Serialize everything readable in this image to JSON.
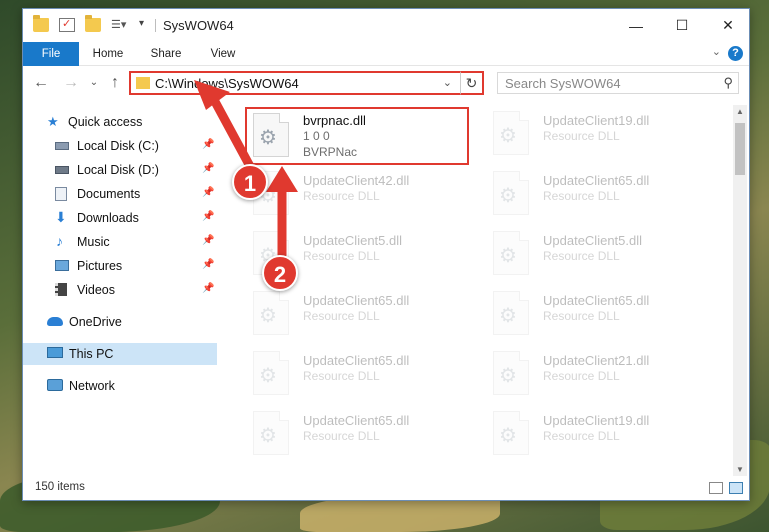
{
  "window": {
    "title": "SysWOW64"
  },
  "ribbon": {
    "tabs": [
      "File",
      "Home",
      "Share",
      "View"
    ],
    "help": "?"
  },
  "nav": {
    "address": "C:\\Windows\\SysWOW64",
    "search_placeholder": "Search SysWOW64"
  },
  "sidebar": {
    "items": [
      {
        "label": "Quick access",
        "icon": "star-icon",
        "pinned": false
      },
      {
        "label": "Local Disk (C:)",
        "icon": "drive-icon",
        "pinned": true
      },
      {
        "label": "Local Disk (D:)",
        "icon": "drive-icon",
        "pinned": true
      },
      {
        "label": "Documents",
        "icon": "documents-icon",
        "pinned": true
      },
      {
        "label": "Downloads",
        "icon": "download-icon",
        "pinned": true
      },
      {
        "label": "Music",
        "icon": "music-icon",
        "pinned": true
      },
      {
        "label": "Pictures",
        "icon": "pictures-icon",
        "pinned": true
      },
      {
        "label": "Videos",
        "icon": "videos-icon",
        "pinned": true
      },
      {
        "label": "OneDrive",
        "icon": "cloud-icon",
        "pinned": false
      },
      {
        "label": "This PC",
        "icon": "computer-icon",
        "pinned": false,
        "selected": true
      },
      {
        "label": "Network",
        "icon": "network-icon",
        "pinned": false
      }
    ]
  },
  "files": [
    {
      "name": "bvrpnac.dll",
      "line2": "1 0 0",
      "line3": "BVRPNac",
      "highlight": true
    },
    {
      "name": "UpdateClient19.dll",
      "line2": "Resource DLL"
    },
    {
      "name": "UpdateClient42.dll",
      "line2": "Resource DLL"
    },
    {
      "name": "UpdateClient65.dll",
      "line2": "Resource DLL"
    },
    {
      "name": "UpdateClient5.dll",
      "line2": "Resource DLL"
    },
    {
      "name": "UpdateClient5.dll",
      "line2": "Resource DLL"
    },
    {
      "name": "UpdateClient65.dll",
      "line2": "Resource DLL"
    },
    {
      "name": "UpdateClient65.dll",
      "line2": "Resource DLL"
    },
    {
      "name": "UpdateClient65.dll",
      "line2": "Resource DLL"
    },
    {
      "name": "UpdateClient21.dll",
      "line2": "Resource DLL"
    },
    {
      "name": "UpdateClient65.dll",
      "line2": "Resource DLL"
    },
    {
      "name": "UpdateClient19.dll",
      "line2": "Resource DLL"
    }
  ],
  "status": {
    "count": "150 items"
  },
  "annotations": {
    "badge1": "1",
    "badge2": "2",
    "color": "#e0392f"
  }
}
